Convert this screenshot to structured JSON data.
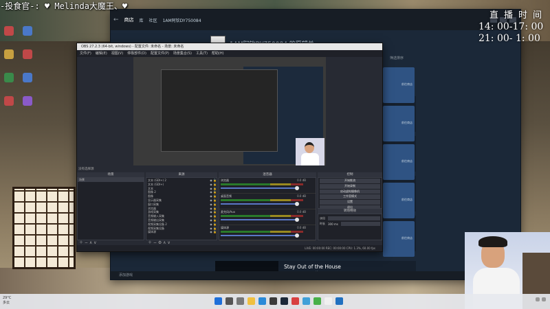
{
  "overlay": {
    "name_banner": "-投食官-: ♥ Melinda大魔王、♥",
    "live_time_label": "直播时间",
    "live_time_start": "14: 00-17: 00",
    "live_time_end": "21: 00- 1: 00"
  },
  "steam": {
    "nav": {
      "store": "商店",
      "library": "库",
      "community": "社区",
      "username": "1AM阿钦DY750084"
    },
    "wishlist_title": "1AM阿钦DY750084 的愿望单",
    "sort_label": "筛选排序",
    "games": [
      {
        "name": "Stay Out of the House",
        "sub": "下载"
      }
    ],
    "card_price_label": "前往商店",
    "bottom_text": "添加游戏"
  },
  "obs": {
    "title": "OBS 27.2.3 (64-bit, windows) - 配置文件: 未命名 - 场景: 未命名",
    "menu": [
      "文件(F)",
      "编辑(E)",
      "视图(V)",
      "停靠部件(D)",
      "配置文件(P)",
      "场景集合(S)",
      "工具(T)",
      "帮助(H)"
    ],
    "scene_label": "没有选择源",
    "docks": {
      "scenes": "场景",
      "sources": "来源",
      "mixer": "混音器",
      "transitions": "转场特效",
      "controls": "控制"
    },
    "scenes": [
      "场景"
    ],
    "sources": [
      "文本 (GDI+) 2",
      "文本 (GDI+)",
      "文本",
      "图像 2",
      "图像",
      "显示器采集",
      "窗口采集",
      "浏览器",
      "游戏采集",
      "音频输入采集",
      "音频输出采集",
      "视频采集设备 2",
      "视频采集设备",
      "媒体源"
    ],
    "mixer_channels": [
      {
        "name": "浏览器",
        "db": "0.0 dB"
      },
      {
        "name": "桌面音频",
        "db": "0.0 dB"
      },
      {
        "name": "麦克风/Aux",
        "db": "0.0 dB"
      },
      {
        "name": "媒体源",
        "db": "0.0 dB"
      }
    ],
    "controls": [
      "开始推流",
      "开始录制",
      "启动虚拟摄像机",
      "工作室模式",
      "设置",
      "退出"
    ],
    "transition_type": "淡出",
    "transition_duration_label": "时长",
    "transition_duration": "300 ms",
    "status": "LIVE: 00:00:00   REC: 00:00:00   CPU: 1.3%, 60.00 fps"
  },
  "taskbar": {
    "weather_temp": "29°C",
    "weather_desc": "多云"
  },
  "colors": {
    "steam_bg": "#1b2838",
    "steam_card": "#2f5383",
    "obs_bg": "#272a33",
    "obs_fader": "#5a78c8"
  }
}
